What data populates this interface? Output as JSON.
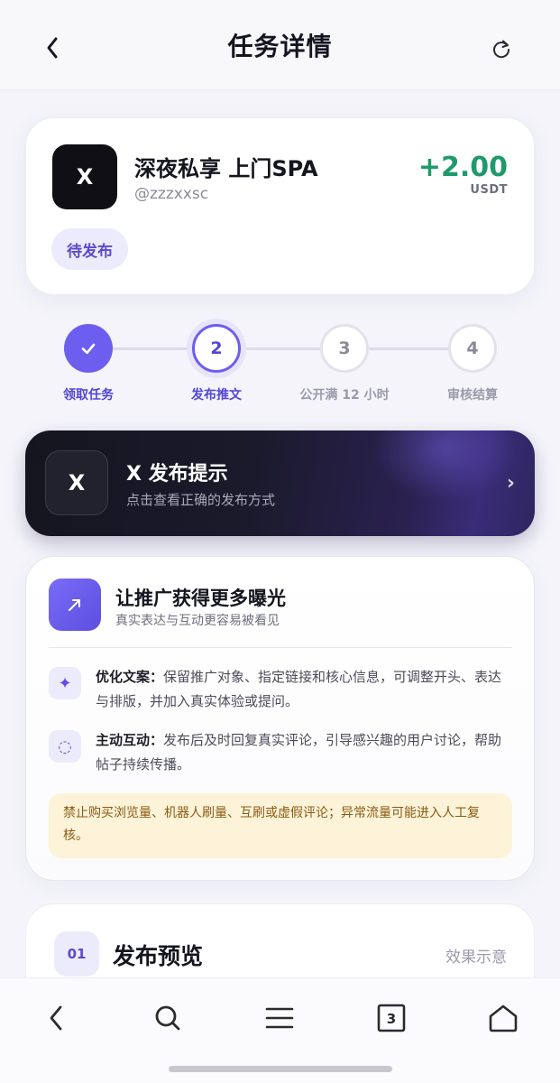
{
  "header": {
    "title": "任务详情",
    "back_icon": "chevron-left-icon",
    "refresh_icon": "refresh-icon"
  },
  "task": {
    "logo_text": "X",
    "name": "深夜私享 上门SPA",
    "handle": "@zzzxxsc",
    "reward_amount": "+2.00",
    "reward_unit": "USDT",
    "status": "待发布"
  },
  "steps": [
    {
      "label": "领取任务",
      "state": "done"
    },
    {
      "num": "2",
      "label": "发布推文",
      "state": "active"
    },
    {
      "num": "3",
      "label": "公开满 12 小时",
      "state": "todo"
    },
    {
      "num": "4",
      "label": "审核结算",
      "state": "todo"
    }
  ],
  "banner": {
    "icon_text": "X",
    "title": "X 发布提示",
    "subtitle": "点击查看正确的发布方式",
    "chevron": "›"
  },
  "tips": {
    "title": "让推广获得更多曝光",
    "subtitle": "真实表达与互动更容易被看见",
    "items": [
      {
        "icon": "sparkle-icon",
        "glyph": "✦",
        "label": "优化文案：",
        "text": "保留推广对象、指定链接和核心信息，可调整开头、表达与排版，并加入真实体验或提问。"
      },
      {
        "icon": "dotted-circle-icon",
        "glyph": "◌",
        "label": "主动互动：",
        "text": "发布后及时回复真实评论，引导感兴趣的用户讨论，帮助帖子持续传播。"
      }
    ],
    "warning": "禁止购买浏览量、机器人刷量、互刷或虚假评论；异常流量可能进入人工复核。"
  },
  "preview": {
    "num": "01",
    "title": "发布预览",
    "hint": "效果示意"
  },
  "bottom_bar": {
    "tab_count": "3"
  },
  "colors": {
    "accent": "#6d5ef0",
    "reward_green": "#1f9a6b",
    "warning_bg": "#fdf3d9",
    "warning_text": "#8a5a12"
  }
}
